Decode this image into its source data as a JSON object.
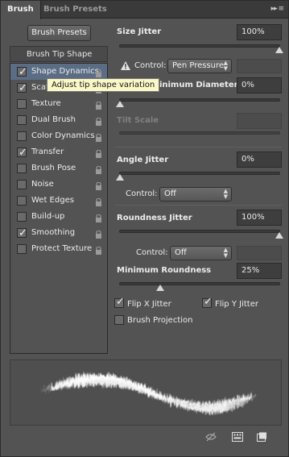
{
  "tabs": [
    {
      "label": "Brush",
      "active": true
    },
    {
      "label": "Brush Presets",
      "active": false
    }
  ],
  "panel_menu_icon": "double-arrow-menu-icon",
  "brush_presets_button": "Brush Presets",
  "tip_shape_label": "Brush Tip Shape",
  "options": [
    {
      "label": "Shape Dynamics",
      "checked": true,
      "selected": true
    },
    {
      "label": "Scattering",
      "checked": true,
      "selected": false
    },
    {
      "label": "Texture",
      "checked": false,
      "selected": false
    },
    {
      "label": "Dual Brush",
      "checked": false,
      "selected": false
    },
    {
      "label": "Color Dynamics",
      "checked": false,
      "selected": false
    },
    {
      "label": "Transfer",
      "checked": true,
      "selected": false
    },
    {
      "label": "Brush Pose",
      "checked": false,
      "selected": false
    },
    {
      "label": "Noise",
      "checked": false,
      "selected": false
    },
    {
      "label": "Wet Edges",
      "checked": false,
      "selected": false
    },
    {
      "label": "Build-up",
      "checked": false,
      "selected": false
    },
    {
      "label": "Smoothing",
      "checked": true,
      "selected": false
    },
    {
      "label": "Protect Texture",
      "checked": false,
      "selected": false
    }
  ],
  "tooltip": "Adjust tip shape variation",
  "size_jitter": {
    "label": "Size Jitter",
    "value": "100%",
    "slider": 1.0
  },
  "size_control": {
    "label": "Control:",
    "value": "Pen Pressure"
  },
  "min_diameter": {
    "label": "Minimum Diameter",
    "value": "0%",
    "slider": 0.0
  },
  "tilt_scale": {
    "label": "Tilt Scale",
    "value": "",
    "enabled": false
  },
  "angle_jitter": {
    "label": "Angle Jitter",
    "value": "0%",
    "slider": 0.0
  },
  "angle_control": {
    "label": "Control:",
    "value": "Off"
  },
  "roundness_jitter": {
    "label": "Roundness Jitter",
    "value": "100%",
    "slider": 1.0
  },
  "roundness_control": {
    "label": "Control:",
    "value": "Off"
  },
  "min_roundness": {
    "label": "Minimum Roundness",
    "value": "25%",
    "slider": 0.25
  },
  "flip_x": {
    "label": "Flip X Jitter",
    "checked": true
  },
  "flip_y": {
    "label": "Flip Y Jitter",
    "checked": true
  },
  "brush_projection": {
    "label": "Brush Projection",
    "checked": false
  },
  "bottom_icons": [
    "brush-eye-icon",
    "grid-panel-icon",
    "new-brush-icon"
  ]
}
